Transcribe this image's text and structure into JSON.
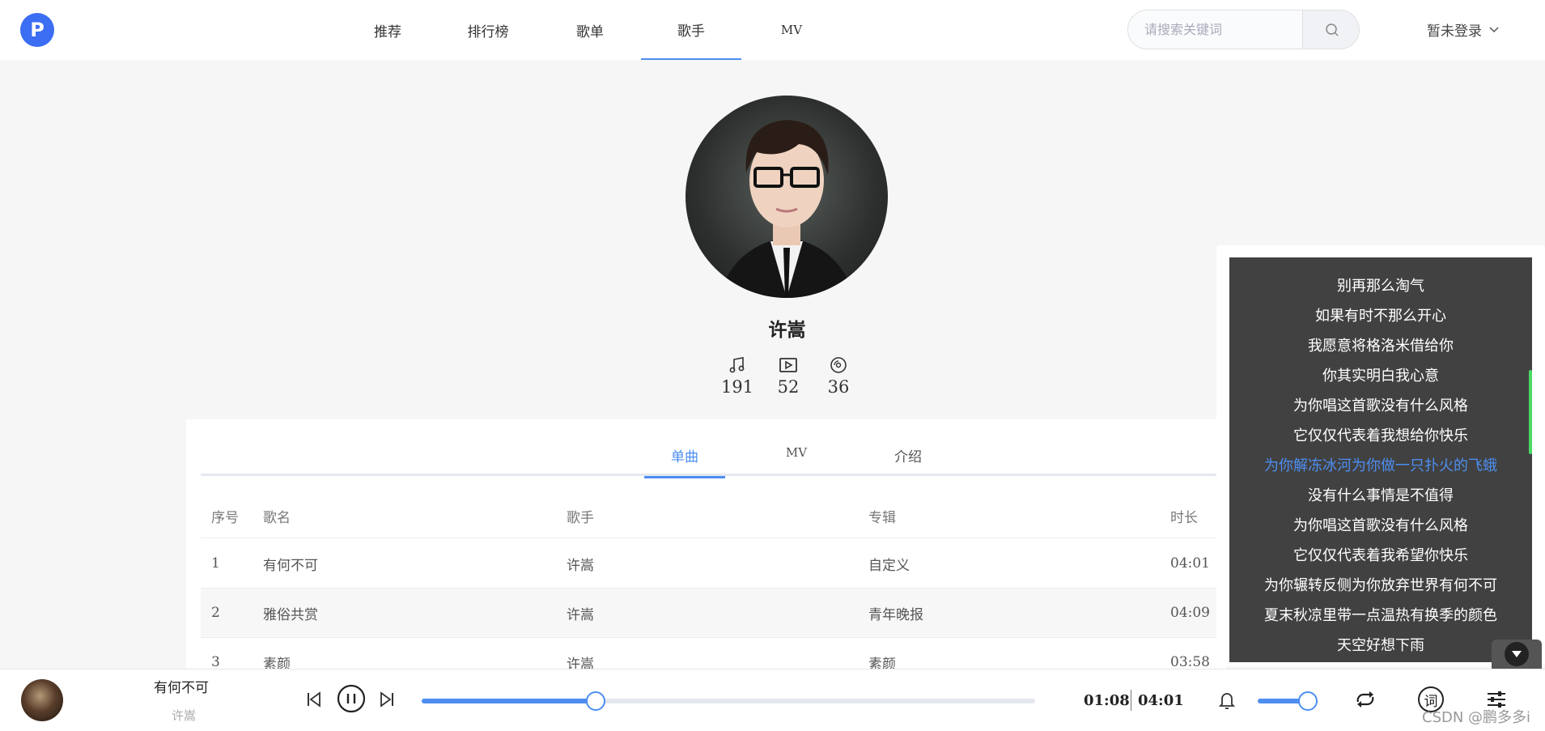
{
  "header": {
    "logo_text": "P",
    "nav": [
      {
        "label": "推荐"
      },
      {
        "label": "排行榜"
      },
      {
        "label": "歌单"
      },
      {
        "label": "歌手"
      },
      {
        "label": "MV"
      }
    ],
    "active_nav": "歌手",
    "search_placeholder": "请搜索关键词",
    "login_label": "暂未登录"
  },
  "artist": {
    "name": "许嵩",
    "stats": {
      "songs": "191",
      "mvs": "52",
      "albums": "36"
    }
  },
  "tabs": [
    {
      "label": "单曲"
    },
    {
      "label": "MV"
    },
    {
      "label": "介绍"
    }
  ],
  "active_tab": "单曲",
  "table": {
    "headers": {
      "index": "序号",
      "name": "歌名",
      "singer": "歌手",
      "album": "专辑",
      "duration": "时长"
    },
    "rows": [
      {
        "index": "1",
        "name": "有何不可",
        "singer": "许嵩",
        "album": "自定义",
        "duration": "04:01"
      },
      {
        "index": "2",
        "name": "雅俗共赏",
        "singer": "许嵩",
        "album": "青年晚报",
        "duration": "04:09"
      },
      {
        "index": "3",
        "name": "素颜",
        "singer": "许嵩",
        "album": "素颜",
        "duration": "03:58"
      }
    ]
  },
  "lyrics": {
    "lines": [
      "别再那么淘气",
      "如果有时不那么开心",
      "我愿意将格洛米借给你",
      "你其实明白我心意",
      "为你唱这首歌没有什么风格",
      "它仅仅代表着我想给你快乐",
      "为你解冻冰河为你做一只扑火的飞蛾",
      "没有什么事情是不值得",
      "为你唱这首歌没有什么风格",
      "它仅仅代表着我希望你快乐",
      "为你辗转反侧为你放弃世界有何不可",
      "夏末秋凉里带一点温热有换季的颜色",
      "天空好想下雨"
    ],
    "current_index": 6
  },
  "player": {
    "title": "有何不可",
    "artist": "许嵩",
    "current_time": "01:08",
    "total_time": "04:01",
    "progress": 0.283,
    "volume": 0.82,
    "lyric_button": "词"
  },
  "watermark": "CSDN @鹏多多i",
  "colors": {
    "accent": "#4d8ef0",
    "lyric_bg": "#414141",
    "page_bg": "#f6f6f6"
  }
}
